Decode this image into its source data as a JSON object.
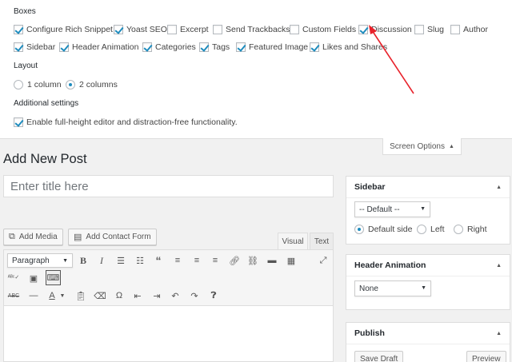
{
  "screen_options": {
    "boxes_heading": "Boxes",
    "boxes": [
      {
        "label": "Configure Rich Snippet",
        "checked": true
      },
      {
        "label": "Yoast SEO",
        "checked": true
      },
      {
        "label": "Excerpt",
        "checked": false
      },
      {
        "label": "Send Trackbacks",
        "checked": false
      },
      {
        "label": "Custom Fields",
        "checked": false
      },
      {
        "label": "Discussion",
        "checked": true
      },
      {
        "label": "Slug",
        "checked": false
      },
      {
        "label": "Author",
        "checked": false
      },
      {
        "label": "Sidebar",
        "checked": true
      },
      {
        "label": "Header Animation",
        "checked": true
      },
      {
        "label": "Categories",
        "checked": true
      },
      {
        "label": "Tags",
        "checked": true
      },
      {
        "label": "Featured Image",
        "checked": true
      },
      {
        "label": "Likes and Shares",
        "checked": true
      }
    ],
    "layout_heading": "Layout",
    "layout_options": [
      {
        "label": "1 column",
        "selected": false
      },
      {
        "label": "2 columns",
        "selected": true
      }
    ],
    "additional_heading": "Additional settings",
    "fullheight_label": "Enable full-height editor and distraction-free functionality.",
    "fullheight_checked": true,
    "tab_label": "Screen Options",
    "annotation_color": "#e8222b"
  },
  "main": {
    "page_title": "Add New Post",
    "title_placeholder": "Enter title here",
    "add_media": "Add Media",
    "add_contact_form": "Add Contact Form",
    "tab_visual": "Visual",
    "tab_text": "Text",
    "format_select": "Paragraph"
  },
  "sidebar_box": {
    "title": "Sidebar",
    "select_value": "-- Default --",
    "sides": [
      {
        "label": "Default side",
        "selected": true
      },
      {
        "label": "Left",
        "selected": false
      },
      {
        "label": "Right",
        "selected": false
      }
    ]
  },
  "header_animation_box": {
    "title": "Header Animation",
    "select_value": "None"
  },
  "publish_box": {
    "title": "Publish",
    "save_draft": "Save Draft",
    "preview": "Preview"
  }
}
